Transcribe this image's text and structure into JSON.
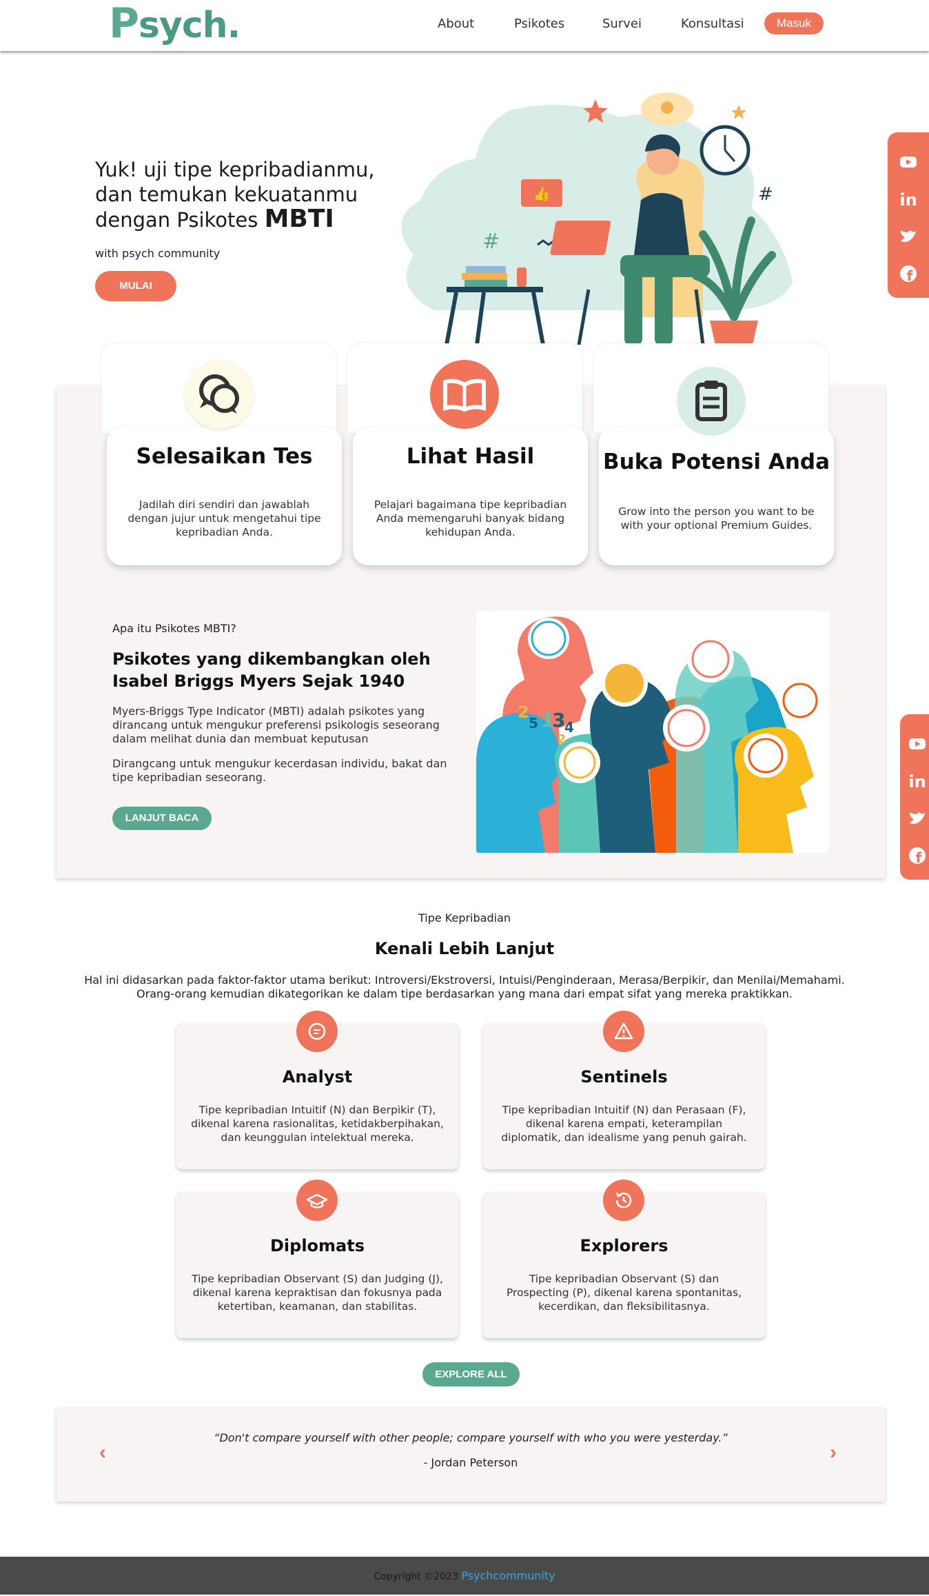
{
  "nav": {
    "logo_p": "P",
    "logo_rest": "sych.",
    "links": [
      "About",
      "Psikotes",
      "Survei",
      "Konsultasi"
    ],
    "login": "Masuk"
  },
  "hero": {
    "title_line1": "Yuk! uji tipe kepribadianmu,",
    "title_line2": "dan temukan kekuatanmu",
    "title_line3_pre": "dengan Psikotes ",
    "title_mbti": "MBTI",
    "subtitle": "with psych community",
    "cta": "MULAI"
  },
  "steps": [
    {
      "title": "Selesaikan Tes",
      "text": "Jadilah diri sendiri dan jawablah dengan jujur untuk mengetahui tipe kepribadian Anda."
    },
    {
      "title": "Lihat Hasil",
      "text": "Pelajari bagaimana tipe kepribadian Anda memengaruhi banyak bidang kehidupan Anda."
    },
    {
      "title": "Buka Potensi Anda",
      "text": "Grow into the person you want to be with your optional Premium Guides."
    }
  ],
  "mbti": {
    "eyebrow": "Apa itu Psikotes MBTI?",
    "title": "Psikotes yang dikembangkan oleh Isabel Briggs Myers Sejak 1940",
    "p1": "Myers-Briggs Type Indicator (MBTI) adalah psikotes yang dirancang untuk mengukur preferensi psikologis seseorang dalam melihat dunia dan membuat keputusan",
    "p2": "Dirangcang untuk mengukur kecerdasan individu, bakat dan tipe kepribadian seseorang.",
    "cta": "LANJUT BACA"
  },
  "types": {
    "eyebrow": "Tipe Kepribadian",
    "title": "Kenali Lebih Lanjut",
    "desc": "Hal ini didasarkan pada faktor-faktor utama berikut: Introversi/Ekstroversi, Intuisi/Penginderaan, Merasa/Berpikir, dan Menilai/Memahami. Orang-orang kemudian dikategorikan ke dalam tipe berdasarkan yang mana dari empat sifat yang mereka praktikkan.",
    "cards": [
      {
        "title": "Analyst",
        "text": "Tipe kepribadian Intuitif (N) dan Berpikir (T), dikenal karena rasionalitas, ketidakberpihakan, dan keunggulan intelektual mereka.",
        "icon": "chat-icon"
      },
      {
        "title": "Sentinels",
        "text": "Tipe kepribadian Intuitif (N) dan Perasaan (F), dikenal karena empati, keterampilan diplomatik, dan idealisme yang penuh gairah.",
        "icon": "warning-icon"
      },
      {
        "title": "Diplomats",
        "text": "Tipe kepribadian Observant (S) dan Judging (J), dikenal karena kepraktisan dan fokusnya pada ketertiban, keamanan, dan stabilitas.",
        "icon": "graduation-cap-icon"
      },
      {
        "title": "Explorers",
        "text": "Tipe kepribadian Observant (S) dan Prospecting (P), dikenal karena spontanitas, kecerdikan, dan fleksibilitasnya.",
        "icon": "history-icon"
      }
    ],
    "cta": "EXPLORE ALL"
  },
  "quote": {
    "text": "“Don't compare yourself with other people; compare yourself with who you were yesterday.”",
    "author": "- Jordan Peterson",
    "prev": "‹",
    "next": "›"
  },
  "footer": {
    "copyright": "Copyright  ©2023 ",
    "link": "Psychcommunity"
  },
  "colors": {
    "accent": "#f0745a",
    "green": "#5aa890",
    "panel": "#f7f4f3",
    "footer": "#4a4a4a"
  }
}
